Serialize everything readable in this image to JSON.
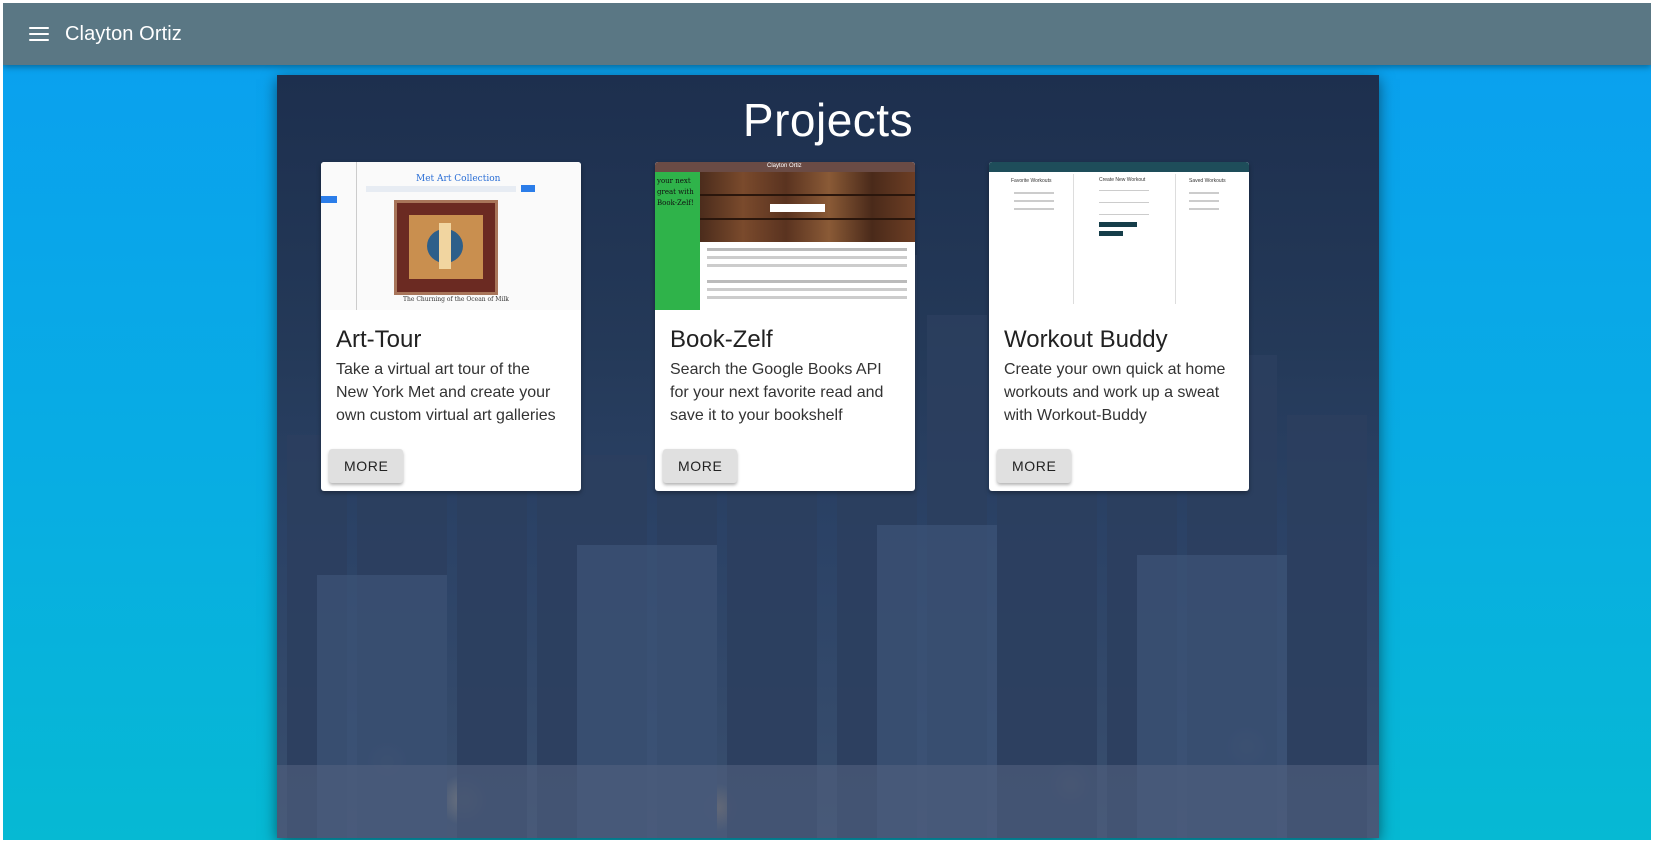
{
  "appbar": {
    "title": "Clayton Ortiz",
    "menu_icon": "menu-icon"
  },
  "page": {
    "title": "Projects"
  },
  "projects": [
    {
      "title": "Art-Tour",
      "description": "Take a virtual art tour of the New York Met and create your own custom virtual art galleries",
      "button": "MORE",
      "thumb": {
        "heading": "Met Art Collection",
        "caption": "The Churning of the Ocean of Milk"
      }
    },
    {
      "title": "Book-Zelf",
      "description": "Search the Google Books API for your next favorite read and save it to your bookshelf",
      "button": "MORE",
      "thumb": {
        "header": "Clayton Ortiz",
        "banner": "your next great with Book-Zelf!"
      }
    },
    {
      "title": "Workout Buddy",
      "description": "Create your own quick at home workouts and work up a sweat with Workout-Buddy",
      "button": "MORE",
      "thumb": {
        "col1": "Favorite Workouts",
        "col2": "Create New Workout",
        "col3": "Saved Workouts"
      }
    }
  ],
  "colors": {
    "appbar": "#5a7784",
    "background_top": "#0a9ff0",
    "background_bottom": "#06b9d3"
  }
}
